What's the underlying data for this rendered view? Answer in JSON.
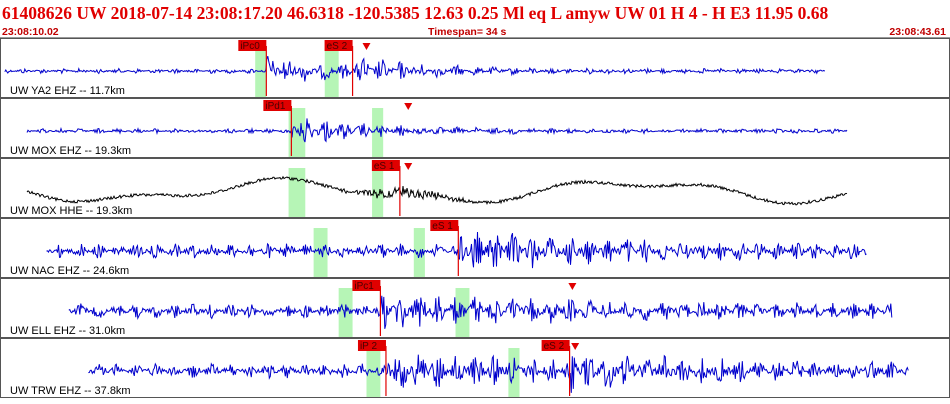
{
  "header": {
    "event_line": "61408626 UW 2018-07-14 23:08:17.20   46.6318 -120.5385  12.63  0.25 Ml  eq  L amyw     UW 01  H   4  - H E3    11.95  0.68",
    "start_time": "23:08:10.02",
    "timespan": "Timespan=  34 s",
    "end_time": "23:08:43.61"
  },
  "colors": {
    "header_text": "#e00000",
    "timestamp_text": "#c00000",
    "trace_vertical": "#0000cc",
    "trace_horizontal": "#000000",
    "pick_box": "#e00000",
    "window_band": "#b6f5b6",
    "panel_border": "#555555"
  },
  "panels": [
    {
      "label": "UW YA2 EHZ -- 11.7km",
      "component": "EHZ",
      "picks": [
        "iPc0",
        "eS 2"
      ],
      "pick_times_s": [
        9.5,
        12.6
      ],
      "theoretical_s": [
        13.1
      ],
      "windows_s": [
        [
          9.1,
          9.5
        ],
        [
          11.6,
          12.1
        ]
      ],
      "trace_span_s": [
        0.1,
        29.6
      ]
    },
    {
      "label": "UW MOX EHZ -- 19.3km",
      "component": "EHZ",
      "picks": [
        "iPd1"
      ],
      "pick_times_s": [
        10.4
      ],
      "theoretical_s": [
        14.6
      ],
      "windows_s": [
        [
          10.3,
          10.9
        ],
        [
          13.3,
          13.7
        ]
      ],
      "trace_span_s": [
        0.9,
        30.4
      ]
    },
    {
      "label": "UW MOX HHE -- 19.3km",
      "component": "HHE",
      "picks": [
        "eS 1"
      ],
      "pick_times_s": [
        14.3
      ],
      "theoretical_s": [
        14.6
      ],
      "windows_s": [
        [
          10.3,
          10.9
        ],
        [
          13.3,
          13.7
        ]
      ],
      "trace_span_s": [
        0.9,
        30.4
      ]
    },
    {
      "label": "UW NAC EHZ -- 24.6km",
      "component": "EHZ",
      "picks": [
        "eS 1"
      ],
      "pick_times_s": [
        16.4
      ],
      "theoretical_s": [],
      "windows_s": [
        [
          11.2,
          11.7
        ],
        [
          14.8,
          15.2
        ]
      ],
      "trace_span_s": [
        1.6,
        31.1
      ]
    },
    {
      "label": "UW ELL EHZ -- 31.0km",
      "component": "EHZ",
      "picks": [
        "iPc1"
      ],
      "pick_times_s": [
        13.6
      ],
      "theoretical_s": [
        20.5
      ],
      "windows_s": [
        [
          12.1,
          12.6
        ],
        [
          16.3,
          16.8
        ]
      ],
      "trace_span_s": [
        2.4,
        32.0
      ]
    },
    {
      "label": "UW TRW EHZ -- 37.8km",
      "component": "EHZ",
      "picks": [
        "iP 2",
        "eS 2"
      ],
      "pick_times_s": [
        13.8,
        20.4
      ],
      "theoretical_s": [
        20.6
      ],
      "windows_s": [
        [
          13.1,
          13.6
        ],
        [
          18.2,
          18.6
        ]
      ],
      "trace_span_s": [
        3.1,
        32.6
      ]
    }
  ]
}
